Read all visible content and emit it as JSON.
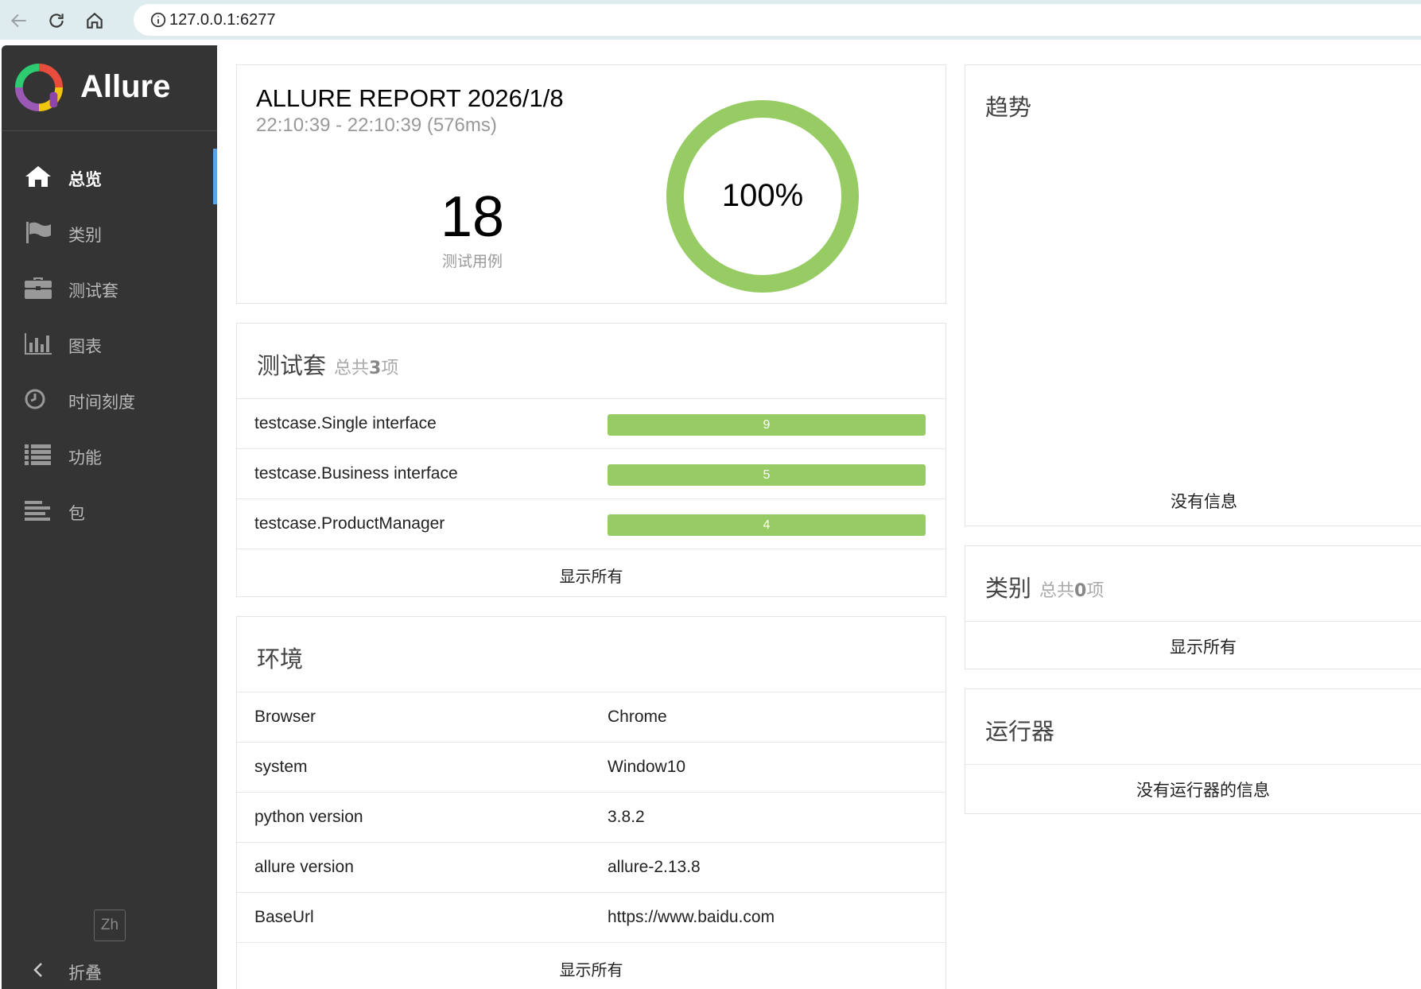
{
  "browser": {
    "url": "127.0.0.1:6277"
  },
  "sidebar": {
    "brand": "Allure",
    "items": [
      {
        "label": "总览",
        "icon": "home-icon",
        "active": true
      },
      {
        "label": "类别",
        "icon": "flag-icon",
        "active": false
      },
      {
        "label": "测试套",
        "icon": "briefcase-icon",
        "active": false
      },
      {
        "label": "图表",
        "icon": "bar-chart-icon",
        "active": false
      },
      {
        "label": "时间刻度",
        "icon": "clock-icon",
        "active": false
      },
      {
        "label": "功能",
        "icon": "list-icon",
        "active": false
      },
      {
        "label": "包",
        "icon": "align-left-icon",
        "active": false
      }
    ],
    "language": "Zh",
    "collapse_label": "折叠"
  },
  "summary": {
    "title": "ALLURE REPORT 2026/1/8",
    "time": "22:10:39 - 22:10:39 (576ms)",
    "count": "18",
    "count_label": "测试用例",
    "percent": "100%",
    "percent_value": 100,
    "ring_color": "#97cc64"
  },
  "suites": {
    "title": "测试套",
    "sub_prefix": "总共",
    "sub_count": "3",
    "sub_suffix": "项",
    "items": [
      {
        "name": "testcase.Single interface",
        "value": "9"
      },
      {
        "name": "testcase.Business interface",
        "value": "5"
      },
      {
        "name": "testcase.ProductManager",
        "value": "4"
      }
    ],
    "show_all": "显示所有",
    "bar_color": "#97cc64"
  },
  "environment": {
    "title": "环境",
    "rows": [
      {
        "key": "Browser",
        "value": "Chrome"
      },
      {
        "key": "system",
        "value": "Window10"
      },
      {
        "key": "python version",
        "value": "3.8.2"
      },
      {
        "key": "allure version",
        "value": "allure-2.13.8"
      },
      {
        "key": "BaseUrl",
        "value": "https://www.baidu.com"
      }
    ],
    "show_all": "显示所有"
  },
  "trend": {
    "title": "趋势",
    "empty": "没有信息"
  },
  "categories": {
    "title": "类别",
    "sub_prefix": "总共",
    "sub_count": "0",
    "sub_suffix": "项",
    "show_all": "显示所有"
  },
  "executors": {
    "title": "运行器",
    "empty": "没有运行器的信息"
  }
}
